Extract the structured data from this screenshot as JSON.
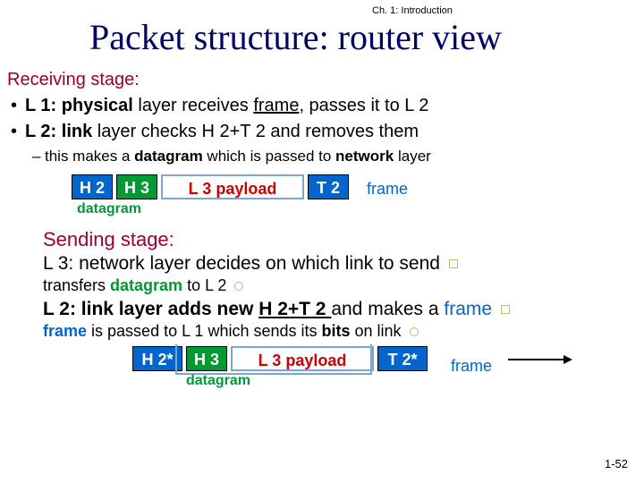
{
  "meta": {
    "chapter": "Ch. 1: Introduction",
    "slideNumber": "1-52"
  },
  "title": "Packet structure: router view",
  "receiving": {
    "heading": "Receiving stage:",
    "bullets": [
      {
        "pre": "L 1:",
        "boldWord": "physical",
        "post": " layer receives ",
        "uword": "frame",
        "post2": ", passes it to L 2"
      },
      {
        "pre": "L 2:",
        "boldWord": "link",
        "post": " layer checks H 2+T 2 and removes them"
      }
    ],
    "subbullet": "this makes a datagram which is passed to network layer"
  },
  "frame1": {
    "h2": "H 2",
    "h3": "H 3",
    "payload": "L 3 payload",
    "t2": "T 2",
    "datagramLabel": "datagram",
    "frameLabel": "frame"
  },
  "sending": {
    "heading": "Sending stage:",
    "l3line": "L 3: network layer decides on which link to send",
    "l3sub_a": "transfers ",
    "l3sub_b": "datagram",
    "l3sub_c": " to L 2",
    "l2line_a": "L 2: link layer adds new ",
    "l2line_b": "H 2+T 2 ",
    "l2line_c": "and makes a ",
    "l2line_d": "frame",
    "l2sub_a": "frame",
    "l2sub_b": " is passed to L 1 which sends its ",
    "l2sub_c": "bits",
    "l2sub_d": " on link"
  },
  "frame2": {
    "h2": "H 2*",
    "h3": "H 3",
    "payload": "L 3 payload",
    "t2": "T 2*",
    "datagramLabel": "datagram",
    "frameLabel": "frame"
  }
}
